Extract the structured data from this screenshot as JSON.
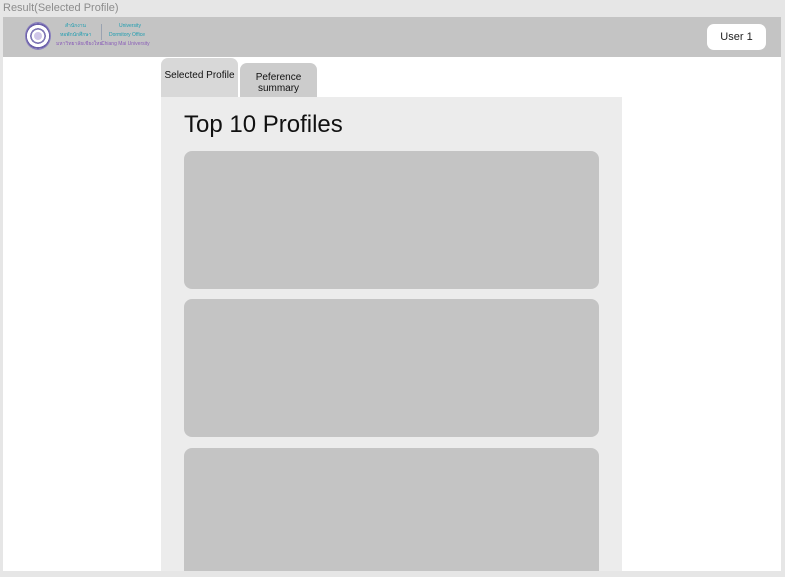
{
  "frame": {
    "title": "Result(Selected Profile)"
  },
  "header": {
    "logo": {
      "thai_line1": "สำนักงาน",
      "thai_line2": "หอพักนักศึกษา",
      "thai_line3": "มหาวิทยาลัยเชียงใหม่",
      "en_line1": "University",
      "en_line2": "Dormitory Office",
      "en_line3": "Chiang Mai University"
    },
    "user_button_label": "User 1"
  },
  "tabs": [
    {
      "label": "Selected Profile",
      "active": true
    },
    {
      "label": "Peference\nsummary",
      "active": false
    }
  ],
  "main": {
    "title": "Top 10 Profiles"
  },
  "colors": {
    "header_bg": "#c4c4c4",
    "panel_bg": "#ececec",
    "card_bg": "#c4c4c4",
    "logo_teal": "#1f9db0",
    "logo_purple": "#8b5fb8"
  }
}
